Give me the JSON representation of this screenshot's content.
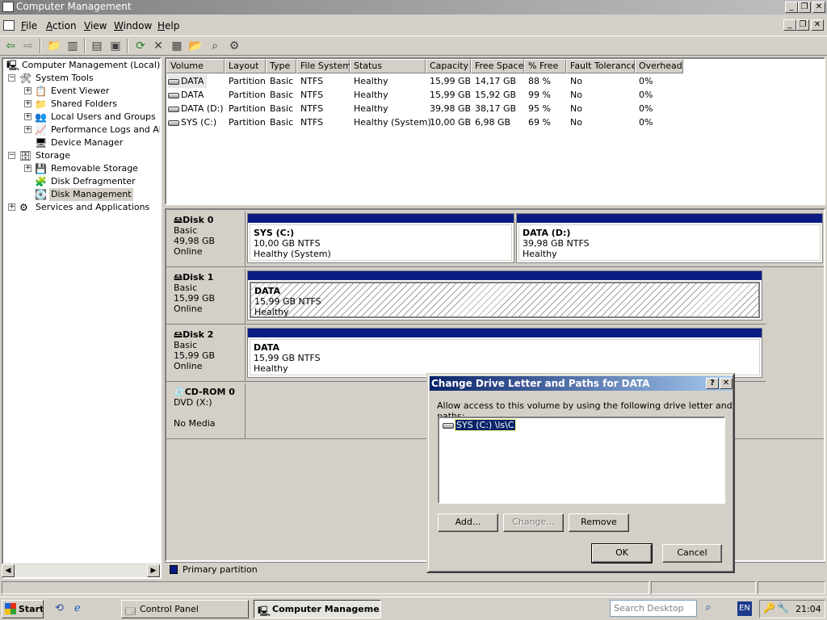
{
  "window": {
    "title": "Computer Management"
  },
  "menubar": {
    "items": [
      {
        "label": "File",
        "u": "F",
        "rest": "ile"
      },
      {
        "label": "Action",
        "u": "A",
        "rest": "ction"
      },
      {
        "label": "View",
        "u": "V",
        "rest": "iew"
      },
      {
        "label": "Window",
        "u": "W",
        "rest": "indow"
      },
      {
        "label": "Help",
        "u": "H",
        "rest": "elp"
      }
    ]
  },
  "tree": {
    "root": "Computer Management (Local)",
    "system_tools": "System Tools",
    "event_viewer": "Event Viewer",
    "shared_folders": "Shared Folders",
    "local_users": "Local Users and Groups",
    "perf_logs": "Performance Logs and Alerts",
    "device_manager": "Device Manager",
    "storage": "Storage",
    "removable_storage": "Removable Storage",
    "disk_defrag": "Disk Defragmenter",
    "disk_management": "Disk Management",
    "services": "Services and Applications"
  },
  "volumes": {
    "headers": [
      "Volume",
      "Layout",
      "Type",
      "File System",
      "Status",
      "Capacity",
      "Free Space",
      "% Free",
      "Fault Tolerance",
      "Overhead"
    ],
    "rows": [
      [
        "DATA",
        "Partition",
        "Basic",
        "NTFS",
        "Healthy",
        "15,99 GB",
        "14,17 GB",
        "88 %",
        "No",
        "0%"
      ],
      [
        "DATA",
        "Partition",
        "Basic",
        "NTFS",
        "Healthy",
        "15,99 GB",
        "15,92 GB",
        "99 %",
        "No",
        "0%"
      ],
      [
        "DATA (D:)",
        "Partition",
        "Basic",
        "NTFS",
        "Healthy",
        "39,98 GB",
        "38,17 GB",
        "95 %",
        "No",
        "0%"
      ],
      [
        "SYS (C:)",
        "Partition",
        "Basic",
        "NTFS",
        "Healthy (System)",
        "10,00 GB",
        "6,98 GB",
        "69 %",
        "No",
        "0%"
      ]
    ]
  },
  "disks": {
    "disk0": {
      "name": "Disk 0",
      "type": "Basic",
      "size": "49,98 GB",
      "state": "Online",
      "p1": {
        "name": "SYS  (C:)",
        "fs": "10,00 GB NTFS",
        "status": "Healthy (System)"
      },
      "p2": {
        "name": "DATA  (D:)",
        "fs": "39,98 GB NTFS",
        "status": "Healthy"
      }
    },
    "disk1": {
      "name": "Disk 1",
      "type": "Basic",
      "size": "15,99 GB",
      "state": "Online",
      "p1": {
        "name": "DATA",
        "fs": "15,99 GB NTFS",
        "status": "Healthy"
      }
    },
    "disk2": {
      "name": "Disk 2",
      "type": "Basic",
      "size": "15,99 GB",
      "state": "Online",
      "p1": {
        "name": "DATA",
        "fs": "15,99 GB NTFS",
        "status": "Healthy"
      }
    },
    "cdrom0": {
      "name": "CD-ROM 0",
      "type": "DVD (X:)",
      "state": "No Media"
    }
  },
  "legend": {
    "primary": "Primary partition",
    "color": "#0a1c84"
  },
  "dialog": {
    "title": "Change Drive Letter and Paths for DATA",
    "help_btn": "?",
    "close_btn": "✕",
    "instruction": "Allow access to this volume by using the following drive letter and paths:",
    "path_item": "SYS (C:) \\ls\\C",
    "add": "Add...",
    "change": "Change...",
    "remove": "Remove",
    "ok": "OK",
    "cancel": "Cancel"
  },
  "taskbar": {
    "start": "Start",
    "task1": "Control Panel",
    "task2": "Computer Manageme...",
    "search_placeholder": "Search Desktop",
    "lang": "EN",
    "clock": "21:04"
  },
  "colors": {
    "selection": "#0a246a",
    "partition_bar": "#0a1c84"
  }
}
